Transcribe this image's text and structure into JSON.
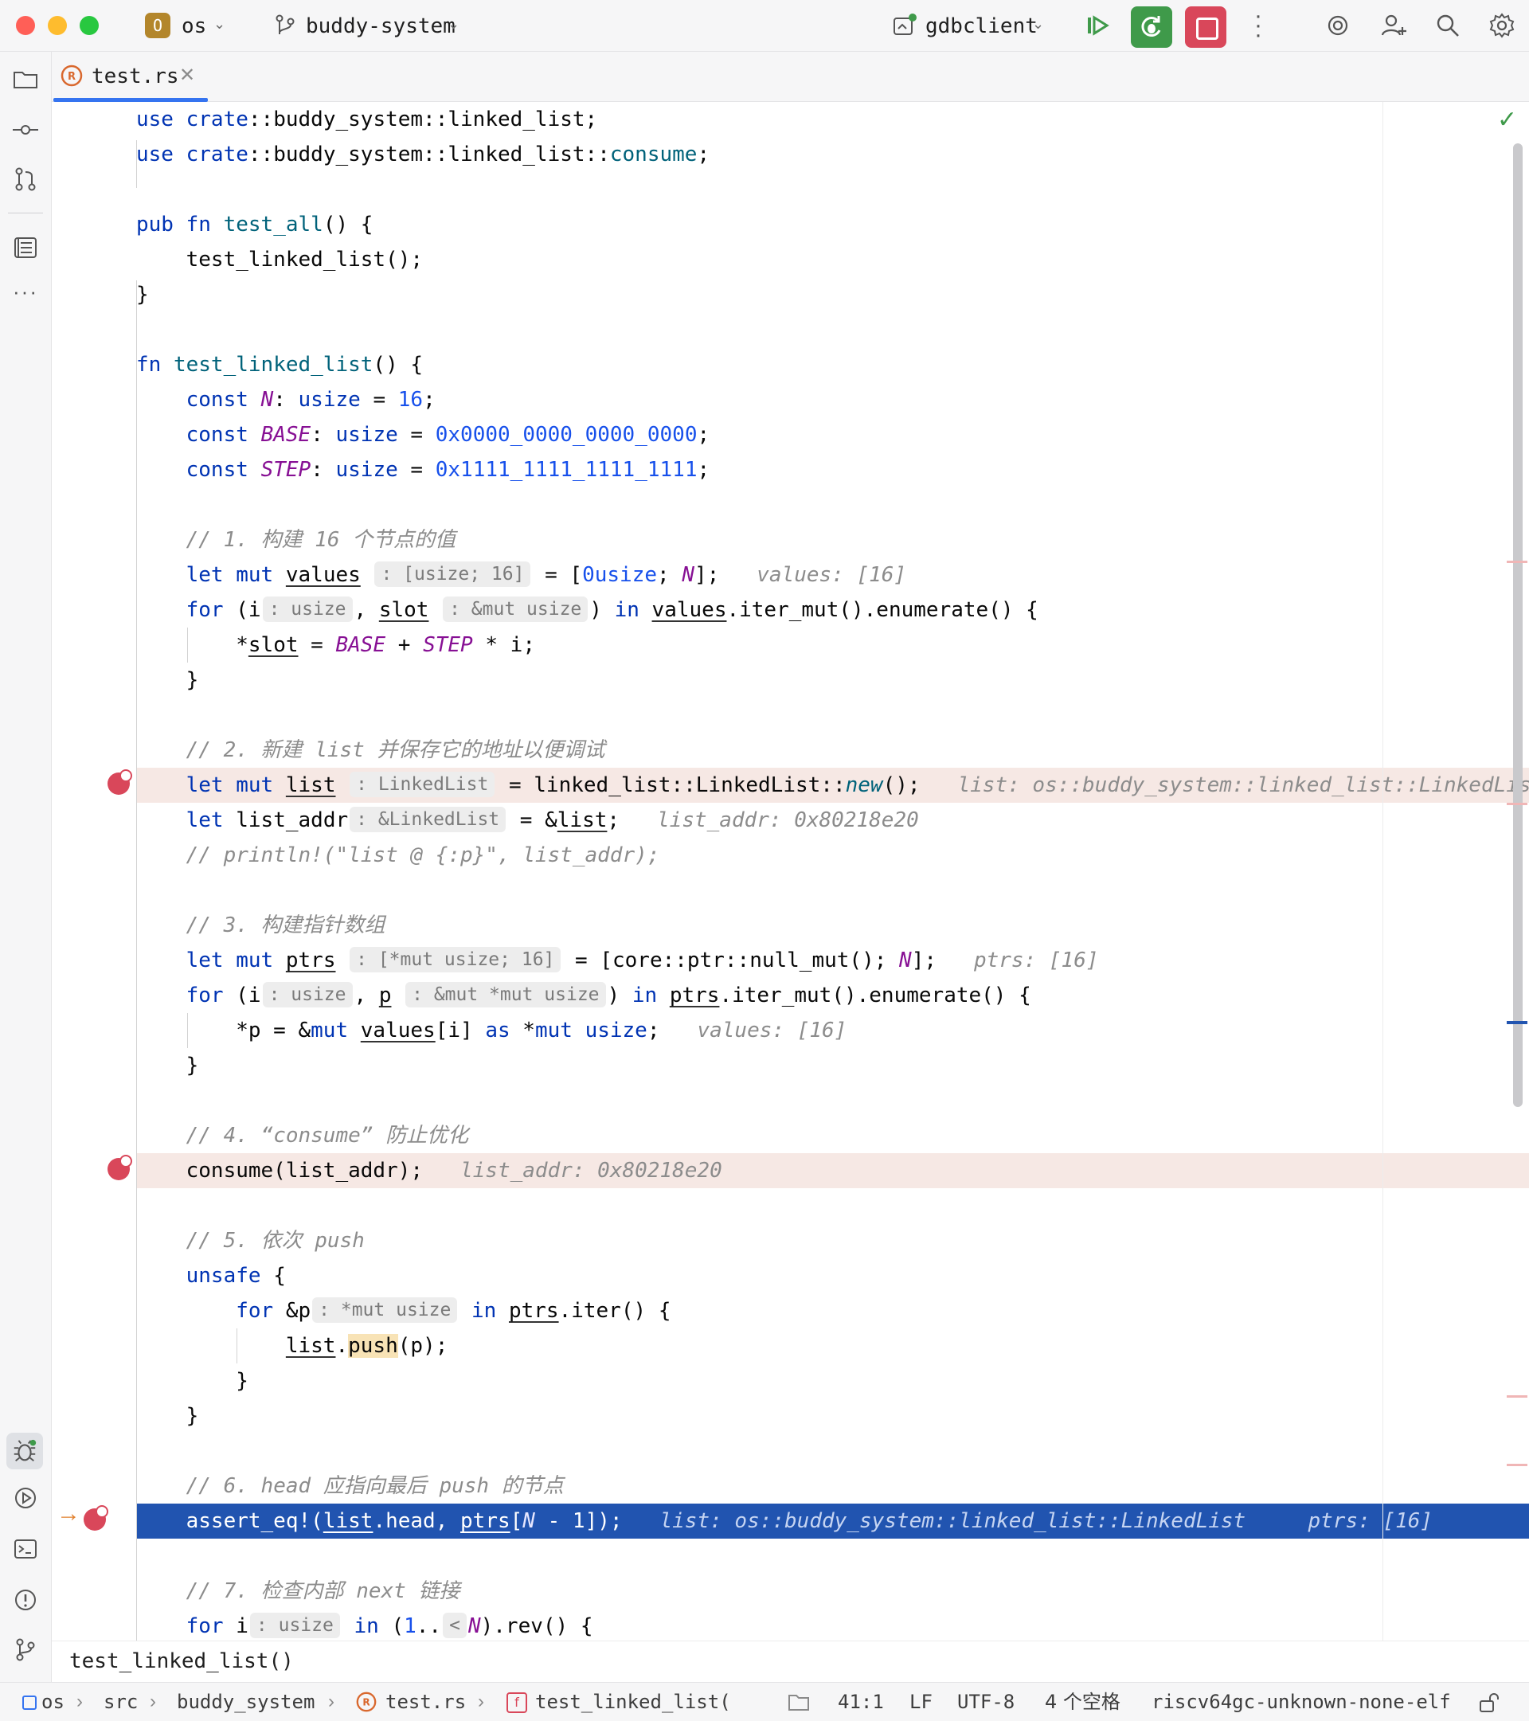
{
  "titlebar": {
    "project_badge": "O",
    "project_name": "os",
    "branch_name": "buddy-system",
    "run_config": "gdbclient"
  },
  "tabs": [
    {
      "label": "test.rs",
      "active": true
    }
  ],
  "editor": {
    "lines": [
      "use crate::buddy_system::linked_list;",
      "use crate::buddy_system::linked_list::consume;",
      "",
      "pub fn test_all() {",
      "test_linked_list();",
      "}",
      "",
      "fn test_linked_list() {",
      "const N: usize = 16;",
      "const BASE: usize = 0x0000_0000_0000_0000;",
      "const STEP: usize = 0x1111_1111_1111_1111;",
      "",
      "// 1. 构建 16 个节点的值",
      "let mut values = [0usize; N];",
      "for (i, slot) in values.iter_mut().enumerate() {",
      "*slot = BASE + STEP * i;",
      "}",
      "",
      "// 2. 新建 list 并保存它的地址以便调试",
      "let mut list = linked_list::LinkedList::new();",
      "let list_addr = &list;",
      "// println!(\"list @ {:p}\", list_addr);",
      "",
      "// 3. 构建指针数组",
      "let mut ptrs = [core::ptr::null_mut(); N];",
      "for (i, p) in ptrs.iter_mut().enumerate() {",
      "*p = &mut values[i] as *mut usize;",
      "}",
      "",
      "// 4. “consume” 防止优化",
      "consume(list_addr);",
      "",
      "// 5. 依次 push",
      "unsafe {",
      "for &p in ptrs.iter() {",
      "list.push(p);",
      "}",
      "}",
      "",
      "// 6. head 应指向最后 push 的节点",
      "assert_eq!(list.head, ptrs[N - 1]);",
      "",
      "// 7. 检查内部 next 链接",
      "for i in (1..N).rev() {"
    ],
    "inlay_hints": {
      "values_type": ": [usize; 16]",
      "i_type": ": usize",
      "slot_type": ": &mut usize",
      "list_type": ": LinkedList",
      "list_addr_type": ": &LinkedList",
      "ptrs_type": ": [*mut usize; 16]",
      "p_type": ": &mut *mut usize",
      "p2_type": ": *mut usize",
      "range_hint": "<"
    },
    "debug_values": {
      "values_line": "values: [16]",
      "list_line": "list: os::buddy_system::linked_list::LinkedList",
      "list_addr_line": "list_addr: 0x80218e20",
      "ptrs_line": "ptrs: [16]",
      "values_line2": "values: [16]",
      "consume_line": "list_addr: 0x80218e20",
      "assert_list": "list: os::buddy_system::linked_list::LinkedList",
      "assert_ptrs": "ptrs: [16]"
    }
  },
  "breadcrumb_function": "test_linked_list()",
  "statusbar": {
    "path": [
      "os",
      "src",
      "buddy_system",
      "test.rs",
      "test_linked_list("
    ],
    "position": "41:1",
    "line_ending": "LF",
    "encoding": "UTF-8",
    "indent": "4 个空格",
    "target": "riscv64gc-unknown-none-elf"
  },
  "colors": {
    "accent": "#3574f0",
    "debug_green": "#3f9a4a",
    "stop_red": "#d9475a",
    "current_line": "#2154b0",
    "breakpoint_line": "#f6e8e4"
  }
}
